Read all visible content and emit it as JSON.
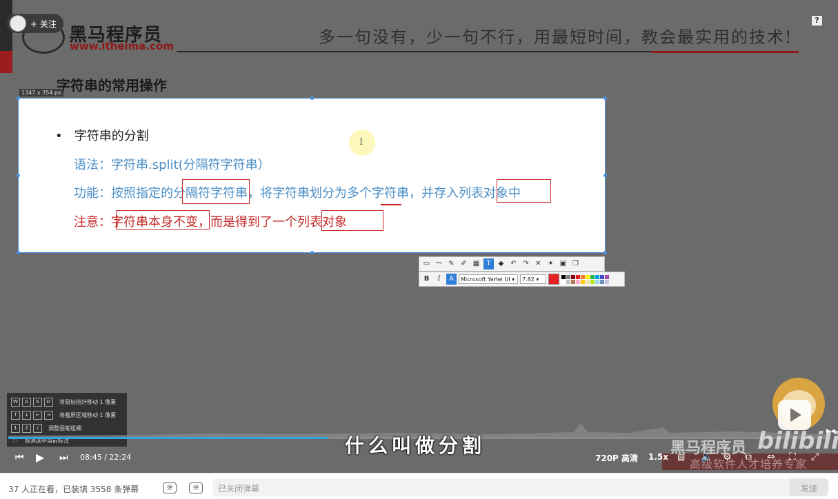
{
  "header": {
    "follow_label": "+ 关注",
    "brand_name": "黑马程序员",
    "brand_url": "www.itheima.com",
    "slogan": "多一句没有，少一句不行，用最短时间，教会最实用的技术!",
    "help_glyph": "?"
  },
  "slide": {
    "heading": "字符串的常用操作",
    "size_label": "1347 x 354  px",
    "bullet": "字符串的分割",
    "syntax": "语法：字符串.split(分隔符字符串）",
    "function": "功能：按照指定的分隔符字符串，将字符串划分为多个字符串，并存入列表对象中",
    "note": "注意：字符串本身不变，而是得到了一个列表对象",
    "cursor_glyph": "I"
  },
  "annotation_toolbar": {
    "font_name": "Microsoft YaHei UI",
    "font_size": "7.82",
    "bold_label": "B",
    "italic_label": "I",
    "text_tool_label": "T",
    "color_label": "A",
    "selected_color": "#e52020",
    "palette": [
      "#000000",
      "#7f7f7f",
      "#880015",
      "#ed1c24",
      "#ff7f27",
      "#fff200",
      "#22b14c",
      "#00a2e8",
      "#3f48cc",
      "#a349a4",
      "#ffffff",
      "#c3c3c3",
      "#b97a57",
      "#ffaec9",
      "#ffc90e",
      "#efe4b0",
      "#b5e61d",
      "#99d9ea",
      "#7092be",
      "#c8bfe7"
    ]
  },
  "shortcuts": [
    {
      "keys": [
        "W",
        "A",
        "S",
        "D"
      ],
      "desc": "将鼠标指针移动 1 像素"
    },
    {
      "keys": [
        "↑",
        "↓",
        "←",
        "→"
      ],
      "desc": "将截屏区域移动 1 像素"
    },
    {
      "keys": [
        "1",
        "2",
        "/"
      ],
      "desc": "调整画笔粗细"
    },
    {
      "keys": [],
      "desc": "取消选中当前标注"
    }
  ],
  "player": {
    "subtitle": "什么叫做分割",
    "current_time": "08:45",
    "total_time": "22:24",
    "time_display": "08:45 / 22:24",
    "progress": 0.39,
    "quality": "720P 高清",
    "speed": "1.5x",
    "watermark_brand": "黑马程序员",
    "watermark_site": "bilibili",
    "watermark_tag": "高级软件人才培养专家"
  },
  "danmaku_bar": {
    "viewers": "37 人正在看，已装填 3558 条弹幕",
    "input_placeholder": "已关闭弹幕",
    "send_label": "发送"
  },
  "colors": {
    "accent": "#2fa6e0",
    "brand_red": "#8e1a1a",
    "slide_blue_text": "#4a8dc5",
    "slide_red_text": "#c62828"
  }
}
